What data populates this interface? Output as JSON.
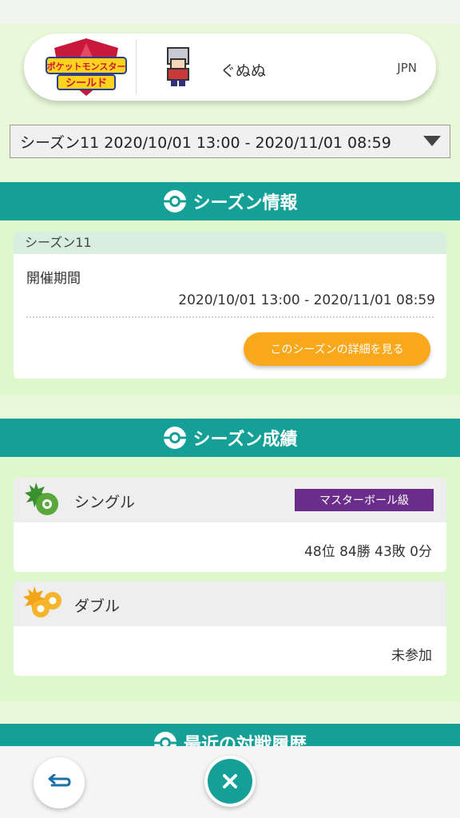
{
  "profile": {
    "game_title_line1": "ポケットモンスター",
    "game_title_line2": "シールド",
    "name": "ぐぬぬ",
    "region": "JPN"
  },
  "season_selector": {
    "selected": "シーズン11 2020/10/01 13:00 - 2020/11/01 08:59"
  },
  "season_info": {
    "title": "シーズン情報",
    "card_title": "シーズン11",
    "period_label": "開催期間",
    "period_value": "2020/10/01 13:00 - 2020/11/01 08:59",
    "detail_button": "このシーズンの詳細を見る"
  },
  "season_results": {
    "title": "シーズン成績",
    "single": {
      "label": "シングル",
      "rank": "マスターボール級",
      "stats": "48位 84勝 43敗 0分"
    },
    "double": {
      "label": "ダブル",
      "stats": "未参加"
    }
  },
  "recent_battles": {
    "title": "最近の対戦履歴"
  },
  "colors": {
    "teal": "#14a096",
    "orange": "#f9a81b",
    "purple": "#6a2e8a",
    "light_green": "#e8f8d8"
  },
  "icons": {
    "back": "back-arrow-icon",
    "close": "close-icon",
    "ball": "pokeball-icon"
  }
}
